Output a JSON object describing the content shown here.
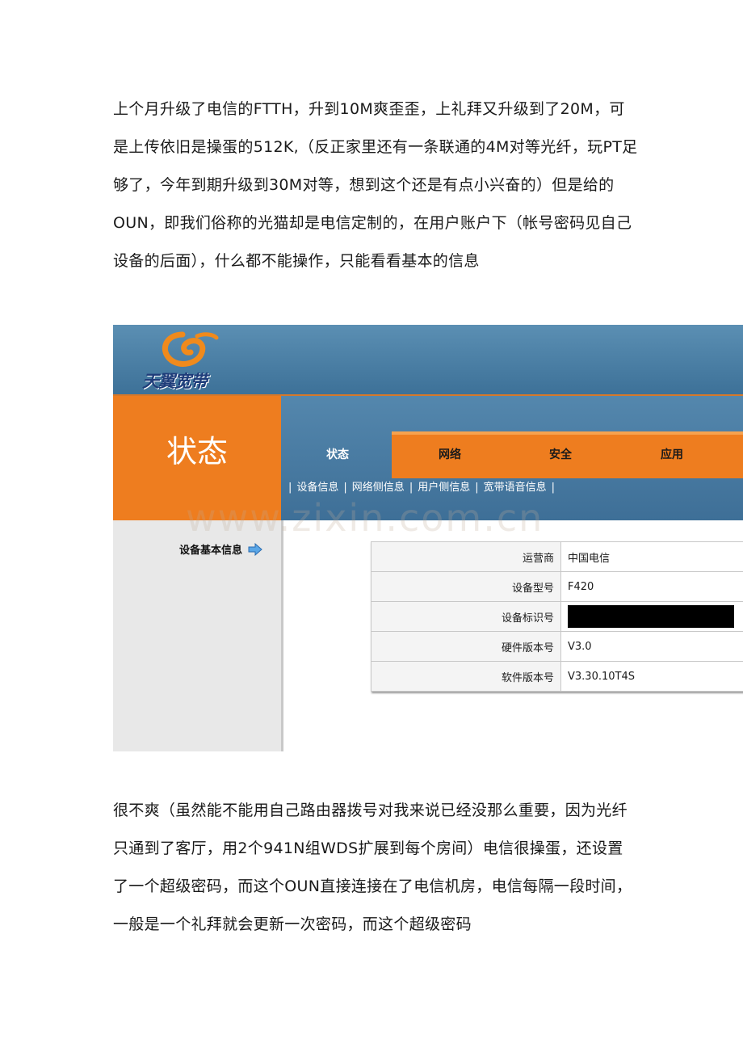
{
  "article": {
    "paragraph_1": "上个月升级了电信的FTTH，升到10M爽歪歪，上礼拜又升级到了20M，可是上传依旧是操蛋的512K,（反正家里还有一条联通的4M对等光纤，玩PT足够了，今年到期升级到30M对等，想到这个还是有点小兴奋的）但是给的OUN，即我们俗称的光猫却是电信定制的，在用户账户下（帐号密码见自己设备的后面），什么都不能操作，只能看看基本的信息",
    "paragraph_2": "很不爽（虽然能不能用自己路由器拨号对我来说已经没那么重要，因为光纤只通到了客厅，用2个941N组WDS扩展到每个房间）电信很操蛋，还设置了一个超级密码，而这个OUN直接连接在了电信机房，电信每隔一段时间，一般是一个礼拜就会更新一次密码，而这个超级密码"
  },
  "router_ui": {
    "logo_text": "天翼宽带",
    "section_title": "状态",
    "tabs": [
      "状态",
      "网络",
      "安全",
      "应用"
    ],
    "active_tab": 0,
    "sublinks": [
      "设备信息",
      "网络侧信息",
      "用户侧信息",
      "宽带语音信息"
    ],
    "left_nav": "设备基本信息",
    "watermark": "www.zixin.com.cn",
    "info_rows": [
      {
        "label": "运营商",
        "value": "中国电信"
      },
      {
        "label": "设备型号",
        "value": "F420"
      },
      {
        "label": "设备标识号",
        "value": ""
      },
      {
        "label": "硬件版本号",
        "value": "V3.0"
      },
      {
        "label": "软件版本号",
        "value": "V3.30.10T4S"
      }
    ],
    "colors": {
      "orange": "#ee7d1f",
      "blue": "#4a7ea6"
    }
  }
}
